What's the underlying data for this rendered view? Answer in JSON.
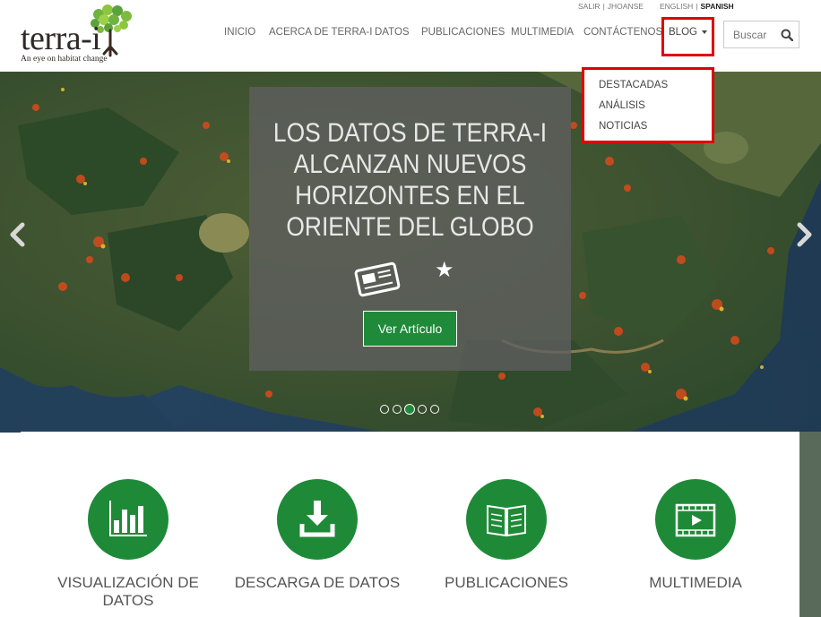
{
  "brand": {
    "name": "terra-i",
    "tagline": "An eye on habitat change"
  },
  "top_links": {
    "logout": "SALIR",
    "user": "JHOANSE",
    "lang_english": "ENGLISH",
    "lang_spanish": "SPANISH",
    "separator": "|"
  },
  "nav": {
    "items": [
      {
        "label": "INICIO"
      },
      {
        "label": "ACERCA DE TERRA-I"
      },
      {
        "label": "DATOS"
      },
      {
        "label": "PUBLICACIONES"
      },
      {
        "label": "MULTIMEDIA"
      },
      {
        "label": "CONTÁCTENOS"
      }
    ],
    "blog_label": "BLOG"
  },
  "search": {
    "placeholder": "Buscar",
    "icon": "search-icon"
  },
  "blog_dropdown": {
    "items": [
      {
        "label": "DESTACADAS"
      },
      {
        "label": "ANÁLISIS"
      },
      {
        "label": "NOTICIAS"
      }
    ]
  },
  "hero": {
    "slide_title": "LOS DATOS DE TERRA-I ALCANZAN NUEVOS HORIZONTES EN EL ORIENTE DEL GLOBO",
    "button_label": "Ver Artículo",
    "slide_count": 5,
    "active_slide": 3,
    "prev_icon": "chevron-left-icon",
    "next_icon": "chevron-right-icon"
  },
  "features": [
    {
      "label": "VISUALIZACIÓN DE DATOS",
      "icon": "bar-chart-icon"
    },
    {
      "label": "DESCARGA DE DATOS",
      "icon": "download-icon"
    },
    {
      "label": "PUBLICACIONES",
      "icon": "book-icon"
    },
    {
      "label": "MULTIMEDIA",
      "icon": "film-icon"
    }
  ],
  "colors": {
    "accent_green": "#1e8a38",
    "highlight_red": "#e00000"
  }
}
